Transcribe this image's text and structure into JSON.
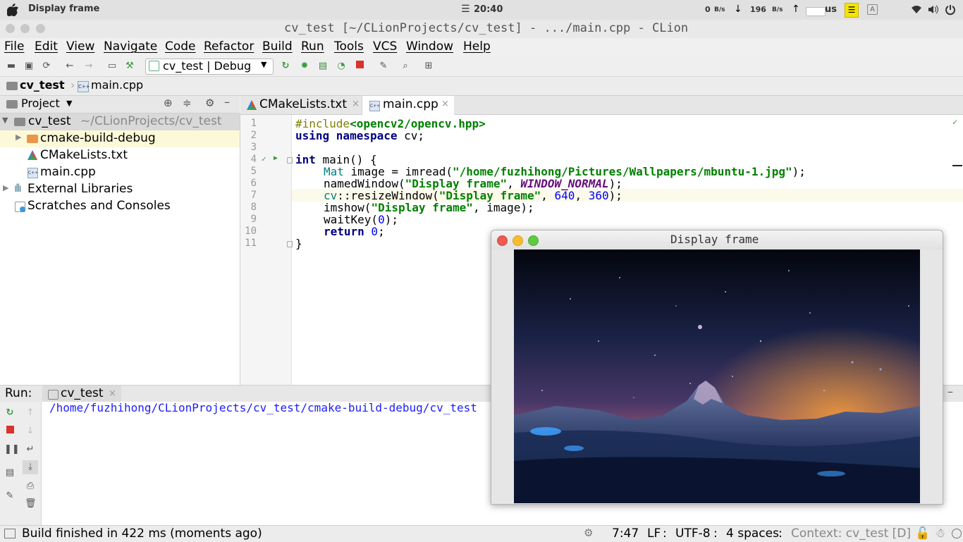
{
  "system_bar": {
    "app_title": "Display frame",
    "clock": "20:40",
    "net_up_value": "0",
    "net_up_unit": "B/s",
    "net_down_value": "196",
    "net_down_unit": "B/s",
    "lang": "us",
    "icons": [
      "apple-icon",
      "hamburger-clock-icon",
      "down-arrow-icon",
      "up-arrow-icon",
      "keyboard-icon",
      "note-icon",
      "input-icon",
      "wifi-icon",
      "volume-icon",
      "power-icon"
    ]
  },
  "window": {
    "title": "cv_test [~/CLionProjects/cv_test] - .../main.cpp - CLion"
  },
  "menu": [
    "File",
    "Edit",
    "View",
    "Navigate",
    "Code",
    "Refactor",
    "Build",
    "Run",
    "Tools",
    "VCS",
    "Window",
    "Help"
  ],
  "toolbar": {
    "config": "cv_test | Debug"
  },
  "breadcrumb": {
    "project": "cv_test",
    "file": "main.cpp"
  },
  "project_panel": {
    "title": "Project",
    "root_name": "cv_test",
    "root_path": "~/CLionProjects/cv_test",
    "items": [
      "cmake-build-debug",
      "CMakeLists.txt",
      "main.cpp",
      "External Libraries",
      "Scratches and Consoles"
    ]
  },
  "editor": {
    "tabs": [
      {
        "label": "CMakeLists.txt",
        "active": false
      },
      {
        "label": "main.cpp",
        "active": true
      }
    ],
    "line_numbers": [
      "1",
      "2",
      "3",
      "4",
      "5",
      "6",
      "7",
      "8",
      "9",
      "10",
      "11"
    ],
    "code": {
      "l1_pp": "#include",
      "l1_inc": "<opencv2/opencv.hpp>",
      "l2_kw": "using namespace",
      "l2_rest": " cv;",
      "l4_kw": "int",
      "l4_rest": " main() {",
      "l5_type": "Mat",
      "l5_a": " image = imread(",
      "l5_str": "\"/home/fuzhihong/Pictures/Wallpapers/mbuntu-1.jpg\"",
      "l5_b": ");",
      "l6_a": "namedWindow(",
      "l6_str": "\"Display frame\"",
      "l6_b": ", ",
      "l6_const": "WINDOW_NORMAL",
      "l6_c": ");",
      "l7_ns": "cv",
      "l7_a": "::resizeWindow(",
      "l7_str": "\"Display frame\"",
      "l7_b": ", ",
      "l7_n1": "640",
      "l7_c": ", ",
      "l7_n2": "360",
      "l7_d": ");",
      "l8_a": "imshow(",
      "l8_str": "\"Display frame\"",
      "l8_b": ", image);",
      "l9_a": "waitKey(",
      "l9_n": "0",
      "l9_b": ");",
      "l10_kw": "return",
      "l10_n": " 0",
      "l10_b": ";",
      "l11": "}"
    }
  },
  "run_panel": {
    "label": "Run:",
    "tab": "cv_test",
    "output": "/home/fuzhihong/CLionProjects/cv_test/cmake-build-debug/cv_test"
  },
  "status_bar": {
    "message": "Build finished in 422 ms (moments ago)",
    "position": "7:47",
    "line_sep": "LF",
    "encoding": "UTF-8",
    "indent": "4 spaces",
    "context": "Context: cv_test [D]"
  },
  "display_window": {
    "title": "Display frame"
  }
}
